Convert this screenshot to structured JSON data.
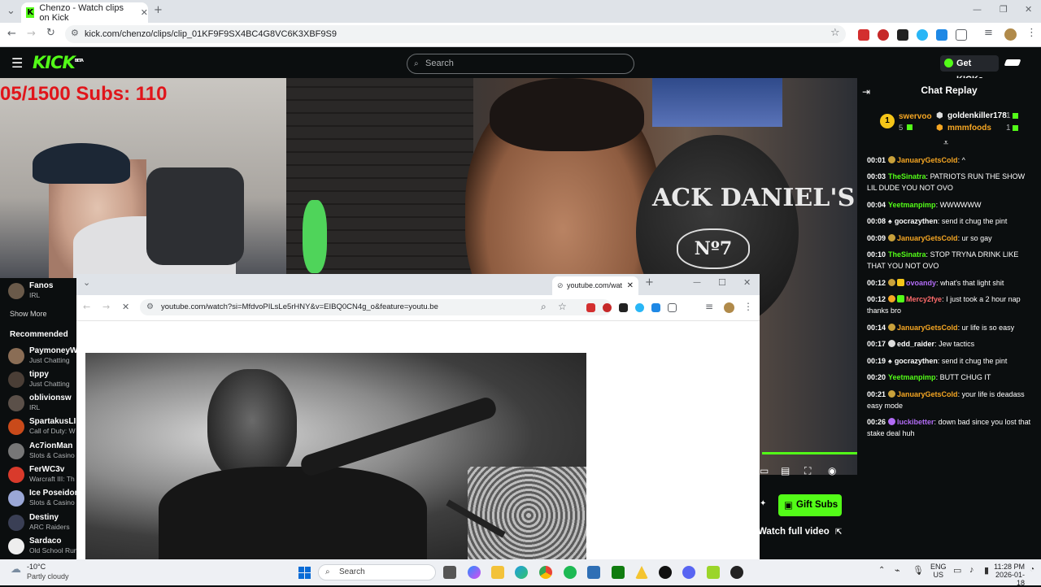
{
  "browser": {
    "tab_title": "Chenzo - Watch clips on Kick",
    "url": "kick.com/chenzo/clips/clip_01KF9F9SX4BC4G8VC6K3XBF9S9"
  },
  "kick": {
    "logo": "KICK",
    "logo_sup": "BETA",
    "search_placeholder": "Search",
    "get_kicks": "Get KICKs"
  },
  "stream": {
    "overlay_text": "05/1500  Subs: 110"
  },
  "sidebar": {
    "following": [
      {
        "name": "Fanos",
        "category": "IRL"
      }
    ],
    "show_more": "Show More",
    "recommended_heading": "Recommended",
    "recommended": [
      {
        "name": "PaymoneyW",
        "category": "Just Chatting"
      },
      {
        "name": "tippy",
        "category": "Just Chatting"
      },
      {
        "name": "oblivionsw",
        "category": "IRL"
      },
      {
        "name": "SpartakusLI",
        "category": "Call of Duty: W"
      },
      {
        "name": "Ac7ionMan",
        "category": "Slots & Casino"
      },
      {
        "name": "FerWC3v",
        "category": "Warcraft III: Th"
      },
      {
        "name": "Ice Poseidon",
        "category": "Slots & Casino"
      },
      {
        "name": "Destiny",
        "category": "ARC Raiders"
      },
      {
        "name": "Sardaco",
        "category": "Old School Run"
      }
    ]
  },
  "popup": {
    "tab_title": "youtube.com/wat",
    "url": "youtube.com/watch?si=MfdvoPILsLe5rHNY&v=EIBQ0CN4g_o&feature=youtu.be"
  },
  "chat": {
    "title": "Chat Replay",
    "gifters": {
      "rank": "1",
      "top": {
        "name": "swervoo",
        "count": "5"
      },
      "others": [
        {
          "name": "goldenkiller178",
          "count": "1"
        },
        {
          "name": "mmmfoods",
          "count": "1"
        }
      ]
    },
    "messages": [
      {
        "time": "00:01",
        "user": "JanuaryGetsCold",
        "color": "#f5a623",
        "text": "^"
      },
      {
        "time": "00:03",
        "user": "TheSinatra",
        "color": "#53fc18",
        "text": "PATRIOTS RUN THE SHOW LIL DUDE YOU NOT OVO"
      },
      {
        "time": "00:04",
        "user": "Yeetmanpimp",
        "color": "#53fc18",
        "text": "WWWWWW"
      },
      {
        "time": "00:08",
        "user": "gocrazythen",
        "color": "#ffffff",
        "text": "send it chug the pint"
      },
      {
        "time": "00:09",
        "user": "JanuaryGetsCold",
        "color": "#f5a623",
        "text": "ur so gay"
      },
      {
        "time": "00:10",
        "user": "TheSinatra",
        "color": "#53fc18",
        "text": "STOP TRYNA DRINK LIKE THAT YOU NOT OVO"
      },
      {
        "time": "00:12",
        "user": "ovoandy",
        "color": "#b26cf5",
        "text": "what's that light shit"
      },
      {
        "time": "00:12",
        "user": "Mercy2fye",
        "color": "#ff6b6b",
        "text": "I just took a 2 hour nap thanks bro"
      },
      {
        "time": "00:14",
        "user": "JanuaryGetsCold",
        "color": "#f5a623",
        "text": "ur life is so easy"
      },
      {
        "time": "00:17",
        "user": "edd_raider",
        "color": "#ffffff",
        "text": "Jew tactics"
      },
      {
        "time": "00:19",
        "user": "gocrazythen",
        "color": "#ffffff",
        "text": "send it chug the pint"
      },
      {
        "time": "00:20",
        "user": "Yeetmanpimp",
        "color": "#53fc18",
        "text": "BUTT CHUG IT"
      },
      {
        "time": "00:21",
        "user": "JanuaryGetsCold",
        "color": "#f5a623",
        "text": "your life is deadass easy mode"
      },
      {
        "time": "00:26",
        "user": "luckibetter",
        "color": "#b26cf5",
        "text": "down bad since you lost that stake deal huh"
      }
    ]
  },
  "player": {
    "gift_subs": "Gift Subs",
    "watch_full": "Watch full video"
  },
  "taskbar": {
    "weather_temp": "-10°C",
    "weather_desc": "Partly cloudy",
    "search": "Search",
    "lang": "ENG",
    "region": "US",
    "time": "11:28 PM",
    "date": "2026-01-18"
  }
}
